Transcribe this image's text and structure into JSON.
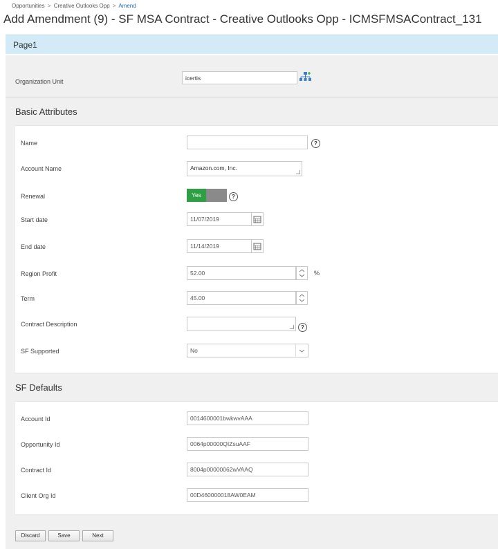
{
  "breadcrumb": {
    "items": [
      "Opportunities",
      "Creative Outlooks Opp",
      "Amend"
    ],
    "separator": ">"
  },
  "page_title": "Add Amendment (9) - SF MSA Contract - Creative Outlooks Opp - ICMSFMSAContract_131",
  "page_tab": "Page1",
  "org_unit": {
    "label": "Organization Unit",
    "value": "icertis",
    "icon": "org-hierarchy-icon"
  },
  "basic": {
    "title": "Basic Attributes",
    "name_label": "Name",
    "name_value": "",
    "account_label": "Account Name",
    "account_value": "Amazon.com, Inc.",
    "renewal_label": "Renewal",
    "renewal_value": "Yes",
    "start_label": "Start date",
    "start_value": "11/07/2019",
    "end_label": "End date",
    "end_value": "11/14/2019",
    "region_label": "Region Profit",
    "region_value": "52.00",
    "region_unit": "%",
    "term_label": "Term",
    "term_value": "45.00",
    "desc_label": "Contract Description",
    "desc_value": "",
    "sfsupported_label": "SF Supported",
    "sfsupported_value": "No",
    "help_glyph": "?"
  },
  "sf_defaults": {
    "title": "SF Defaults",
    "account_id_label": "Account Id",
    "account_id_value": "0014600001bwkwvAAA",
    "opportunity_id_label": "Opportunity Id",
    "opportunity_id_value": "0064p00000QIZsuAAF",
    "contract_id_label": "Contract Id",
    "contract_id_value": "8004p00000062wVAAQ",
    "client_org_id_label": "Client Org Id",
    "client_org_id_value": "00D460000018AW0EAM"
  },
  "buttons": {
    "discard": "Discard",
    "save": "Save",
    "next": "Next"
  },
  "colors": {
    "accent_link": "#1a6fb0",
    "tab_bar": "#d3ebf7",
    "toggle_yes": "#2ea043",
    "toggle_no": "#8a8a8a"
  }
}
